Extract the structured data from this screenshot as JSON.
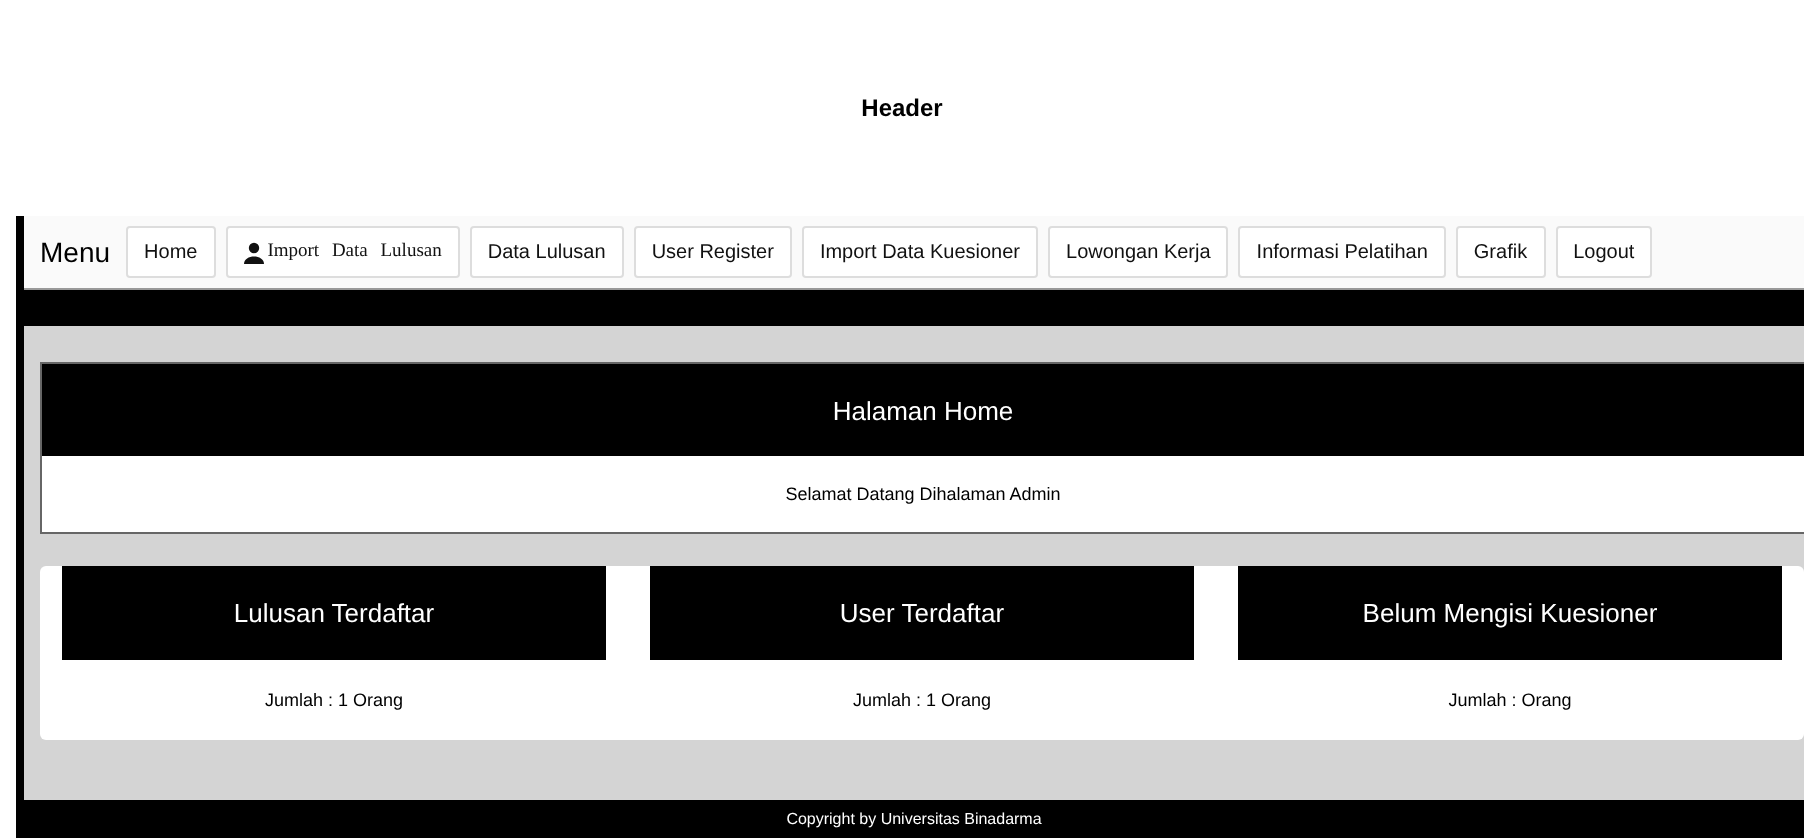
{
  "header": {
    "title": "Header"
  },
  "nav": {
    "label": "Menu",
    "items": [
      {
        "label": "Home",
        "kind": "plain"
      },
      {
        "label": "Import Data Lulusan",
        "kind": "user"
      },
      {
        "label": "Data Lulusan",
        "kind": "plain"
      },
      {
        "label": "User Register",
        "kind": "plain"
      },
      {
        "label": "Import Data Kuesioner",
        "kind": "plain"
      },
      {
        "label": "Lowongan Kerja",
        "kind": "plain"
      },
      {
        "label": "Informasi Pelatihan",
        "kind": "plain"
      },
      {
        "label": "Grafik",
        "kind": "plain"
      },
      {
        "label": "Logout",
        "kind": "plain"
      }
    ]
  },
  "page": {
    "title": "Halaman Home",
    "welcome": "Selamat Datang Dihalaman Admin"
  },
  "cards": [
    {
      "title": "Lulusan Terdaftar",
      "count": "Jumlah : 1 Orang"
    },
    {
      "title": "User Terdaftar",
      "count": "Jumlah : 1 Orang"
    },
    {
      "title": "Belum Mengisi Kuesioner",
      "count": "Jumlah : Orang"
    }
  ],
  "footer": {
    "text": "Copyright by Universitas Binadarma"
  }
}
